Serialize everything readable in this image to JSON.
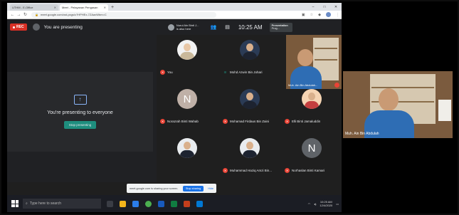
{
  "browser": {
    "tabs": [
      {
        "label": "UTHM - E-Office"
      },
      {
        "label": "Meet - Pelayanan Pengasan"
      }
    ],
    "new_tab": "+",
    "url": "meet.google.com/ost-pxgs/c?HPHEx-7ZAaxWbm=C",
    "window_controls": [
      "–",
      "□",
      "✕"
    ]
  },
  "meet_bar": {
    "rec_label": "REC",
    "presenting_label": "You are presenting",
    "host_name": "Nurul Ain Binti J...",
    "host_sub": "is also here",
    "time": "10:25 AM",
    "presentation_card_line1": "Presentation",
    "presentation_card_line2": "Prog..."
  },
  "stage": {
    "message": "You're presenting to everyone",
    "stop_button": "Stop presenting"
  },
  "participants": [
    {
      "name": "You",
      "muted": true,
      "kind": "photo-hijab"
    },
    {
      "name": "Mohd Azwin Bin Johari",
      "muted": false,
      "kind": "photo"
    },
    {
      "name": "Muh. Ain Bin Abdulah...",
      "muted": true,
      "kind": "camera"
    },
    {
      "name": "Norazrah Binti Wahab",
      "muted": true,
      "kind": "letter",
      "letter": "N"
    },
    {
      "name": "Mohamad Firdaus Bin Zaini",
      "muted": true,
      "kind": "photo"
    },
    {
      "name": "Elli Binti Jamaluddin",
      "muted": true,
      "kind": "photo-orange"
    },
    {
      "name": "",
      "muted": true,
      "kind": "photo-white"
    },
    {
      "name": "Muhammad Haziq Amzi Bin...",
      "muted": true,
      "kind": "photo"
    },
    {
      "name": "Norhaslan Binti Kamari",
      "muted": true,
      "kind": "letter",
      "letter": "N"
    }
  ],
  "toast": {
    "message": "meet.google.com is sharing your screen.",
    "stop_sharing": "Stop sharing",
    "hide": "Hide"
  },
  "taskbar": {
    "search_placeholder": "Type here to search",
    "time": "10:25 AM",
    "date": "12/4/2020"
  },
  "external_cam": {
    "label": "Muh. Ain Bin Abdulah"
  },
  "colors": {
    "rec": "#d93025",
    "stop_button": "#1e8e7e",
    "toast_button": "#1a73e8"
  }
}
